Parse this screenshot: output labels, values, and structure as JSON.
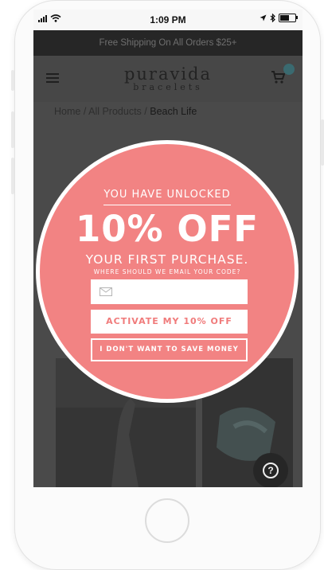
{
  "status_bar": {
    "time": "1:09 PM",
    "battery_level": 0.6,
    "icons": [
      "signal-icon",
      "wifi-icon",
      "location-arrow-icon",
      "bluetooth-icon",
      "battery-icon"
    ]
  },
  "banner": {
    "text": "Free Shipping On All Orders $25+"
  },
  "header": {
    "logo_main": "puravida",
    "logo_sub": "bracelets",
    "icons": [
      "hamburger-menu-icon",
      "cart-icon"
    ]
  },
  "breadcrumb": {
    "items": [
      "Home",
      "All Products"
    ],
    "separator": "/",
    "current": "Beach Life"
  },
  "popup": {
    "unlocked": "YOU HAVE UNLOCKED",
    "discount": "10% OFF",
    "purchase": "YOUR FIRST PURCHASE.",
    "prompt": "WHERE SHOULD WE EMAIL YOUR CODE?",
    "email_value": "",
    "email_placeholder": "",
    "activate_label": "ACTIVATE MY 10% OFF",
    "decline_label": "I DON'T WANT TO SAVE MONEY",
    "background_color": "#f28383",
    "button_text_color": "#f07b7b"
  },
  "help_button": {
    "icon": "question-mark-icon"
  }
}
